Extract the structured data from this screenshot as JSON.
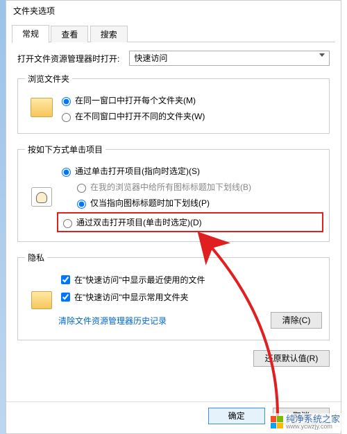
{
  "window": {
    "title": "文件夹选项"
  },
  "tabs": {
    "general": "常规",
    "view": "查看",
    "search": "搜索"
  },
  "open_in": {
    "label": "打开文件资源管理器时打开:",
    "value": "快速访问"
  },
  "browse": {
    "legend": "浏览文件夹",
    "same_window": "在同一窗口中打开每个文件夹(M)",
    "new_window": "在不同窗口中打开不同的文件夹(W)"
  },
  "click": {
    "legend": "按如下方式单击项目",
    "single_open": "通过单击打开项目(指向时选定)(S)",
    "underline_all": "在我的浏览器中给所有图标标题加下划线(B)",
    "underline_point": "仅当指向图标标题时加下划线(P)",
    "double_open": "通过双击打开项目(单击时选定)(D)"
  },
  "privacy": {
    "legend": "隐私",
    "recent_files": "在\"快速访问\"中显示最近使用的文件",
    "frequent_folders": "在\"快速访问\"中显示常用文件夹",
    "clear_label": "清除文件资源管理器历史记录",
    "clear_btn": "清除(C)"
  },
  "restore_btn": "还原默认值(R)",
  "footer": {
    "ok": "确定",
    "cancel": "取消"
  },
  "watermark": {
    "text": "纯净系统之家",
    "url": "www.ycwzjy.com"
  }
}
